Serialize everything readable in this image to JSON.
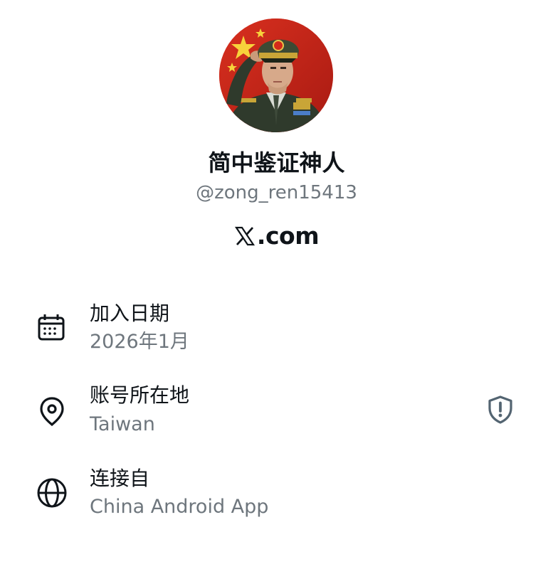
{
  "profile": {
    "display_name": "简中鉴证神人",
    "handle": "@zong_ren15413",
    "site_label": ".com",
    "avatar_icon": "profile-photo",
    "logo_icon": "x-logo-icon"
  },
  "about": {
    "joined": {
      "label": "加入日期",
      "value": "2026年1月",
      "icon": "calendar-icon"
    },
    "location": {
      "label": "账号所在地",
      "value": "Taiwan",
      "icon": "location-pin-icon",
      "badge_icon": "shield-alert-icon"
    },
    "connected": {
      "label": "连接自",
      "value": "China Android App",
      "icon": "globe-icon"
    }
  },
  "colors": {
    "primary_text": "#0f1419",
    "secondary_text": "#6e767d",
    "background": "#ffffff",
    "badge": "#536471"
  }
}
